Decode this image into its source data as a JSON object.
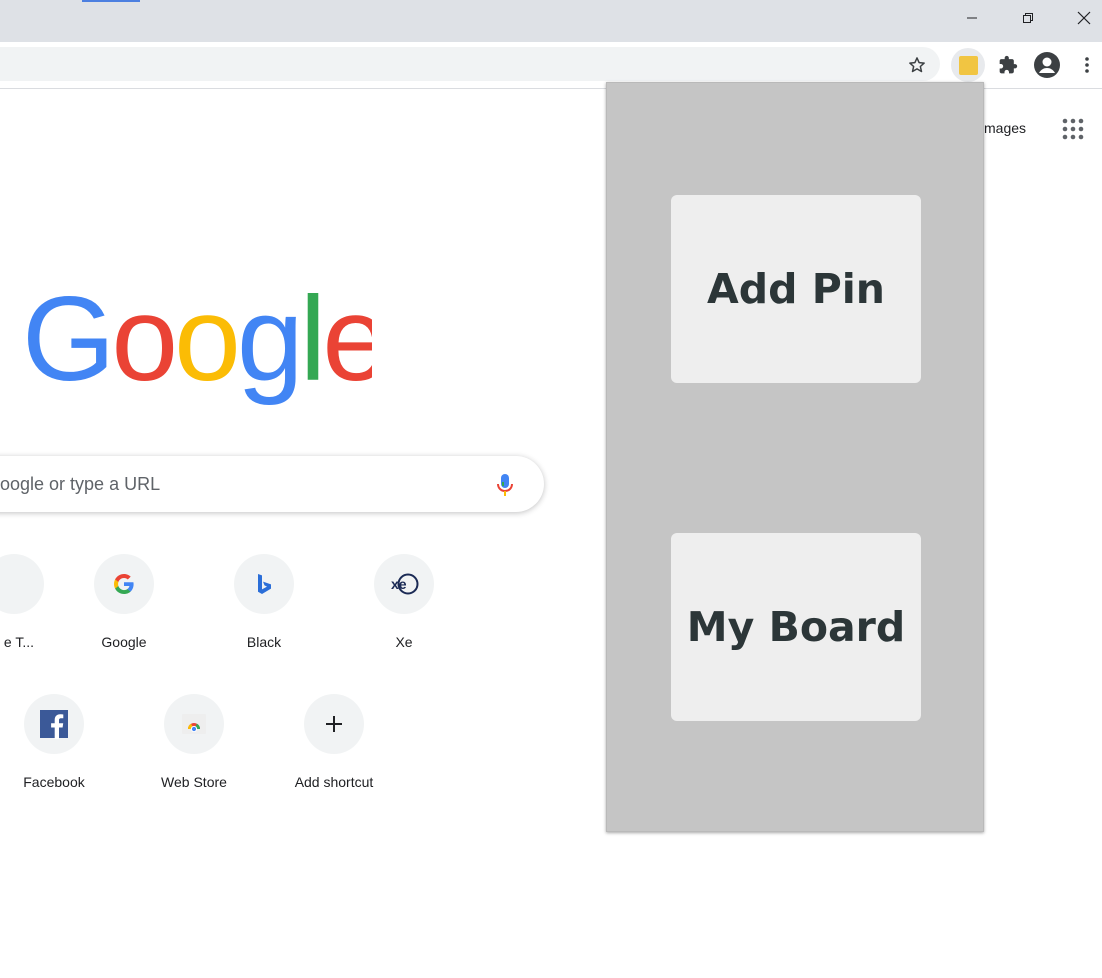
{
  "browser": {
    "window_controls": [
      "minimize-icon",
      "restore-icon",
      "close-icon"
    ],
    "toolbar_icons": [
      "star-icon",
      "extension-icon",
      "puzzle-icon",
      "profile-icon",
      "more-icon"
    ]
  },
  "new_tab": {
    "images_link": "mages",
    "logo_text": "Google",
    "search_placeholder": "oogle or type a URL",
    "shortcuts_row1": [
      {
        "label": "e T...",
        "icon": "partial-shortcut-icon"
      },
      {
        "label": "Google",
        "icon": "google-g-icon"
      },
      {
        "label": "Black",
        "icon": "bing-icon"
      },
      {
        "label": "Xe",
        "icon": "xe-icon"
      }
    ],
    "shortcuts_row2": [
      {
        "label": "Facebook",
        "icon": "facebook-icon"
      },
      {
        "label": "Web Store",
        "icon": "web-store-icon"
      },
      {
        "label": "Add shortcut",
        "icon": "plus-icon"
      }
    ]
  },
  "popup": {
    "add_pin_label": "Add Pin",
    "my_board_label": "My Board"
  },
  "colors": {
    "popup_bg": "#c5c5c5",
    "popup_button_bg": "#eeeeee",
    "popup_text": "#2c3638",
    "extension_icon": "#f1c542"
  }
}
